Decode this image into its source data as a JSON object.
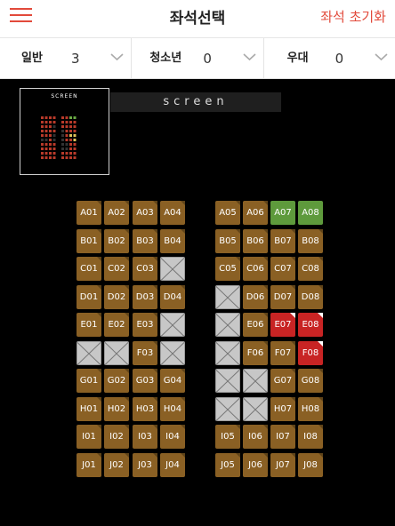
{
  "header": {
    "title": "좌석선택",
    "reset_label": "좌석 초기화"
  },
  "audience": [
    {
      "label": "일반",
      "value": "3"
    },
    {
      "label": "청소년",
      "value": "0"
    },
    {
      "label": "우대",
      "value": "0"
    }
  ],
  "minimap_title": "SCREEN",
  "screen_label": "screen",
  "colors": {
    "available": "#8a6024",
    "selected": "#5e9a3c",
    "reserved": "#c82424",
    "blocked": "#c7c7c7",
    "accent": "#e24a3b"
  },
  "rows": [
    {
      "left": [
        [
          "A01",
          "available"
        ],
        [
          "A02",
          "available"
        ],
        [
          "A03",
          "available"
        ],
        [
          "A04",
          "available"
        ]
      ],
      "right": [
        [
          "A05",
          "available"
        ],
        [
          "A06",
          "available"
        ],
        [
          "A07",
          "selected"
        ],
        [
          "A08",
          "selected"
        ]
      ]
    },
    {
      "left": [
        [
          "B01",
          "available"
        ],
        [
          "B02",
          "available"
        ],
        [
          "B03",
          "available"
        ],
        [
          "B04",
          "available"
        ]
      ],
      "right": [
        [
          "B05",
          "available"
        ],
        [
          "B06",
          "available"
        ],
        [
          "B07",
          "available"
        ],
        [
          "B08",
          "available"
        ]
      ]
    },
    {
      "left": [
        [
          "C01",
          "available"
        ],
        [
          "C02",
          "available"
        ],
        [
          "C03",
          "available"
        ],
        [
          "",
          "blocked"
        ]
      ],
      "right": [
        [
          "C05",
          "available"
        ],
        [
          "C06",
          "available"
        ],
        [
          "C07",
          "available"
        ],
        [
          "C08",
          "available"
        ]
      ]
    },
    {
      "left": [
        [
          "D01",
          "available"
        ],
        [
          "D02",
          "available"
        ],
        [
          "D03",
          "available"
        ],
        [
          "D04",
          "available"
        ]
      ],
      "right": [
        [
          "",
          "blocked"
        ],
        [
          "D06",
          "available"
        ],
        [
          "D07",
          "available"
        ],
        [
          "D08",
          "available"
        ]
      ]
    },
    {
      "left": [
        [
          "E01",
          "available"
        ],
        [
          "E02",
          "available"
        ],
        [
          "E03",
          "available"
        ],
        [
          "",
          "blocked"
        ]
      ],
      "right": [
        [
          "",
          "blocked"
        ],
        [
          "E06",
          "available"
        ],
        [
          "E07",
          "reserved"
        ],
        [
          "E08",
          "reserved"
        ]
      ]
    },
    {
      "left": [
        [
          "",
          "blocked"
        ],
        [
          "",
          "blocked"
        ],
        [
          "F03",
          "available"
        ],
        [
          "",
          "blocked"
        ]
      ],
      "right": [
        [
          "",
          "blocked"
        ],
        [
          "F06",
          "available"
        ],
        [
          "F07",
          "available"
        ],
        [
          "F08",
          "reserved"
        ]
      ]
    },
    {
      "left": [
        [
          "G01",
          "available"
        ],
        [
          "G02",
          "available"
        ],
        [
          "G03",
          "available"
        ],
        [
          "G04",
          "available"
        ]
      ],
      "right": [
        [
          "",
          "blocked"
        ],
        [
          "",
          "blocked"
        ],
        [
          "G07",
          "available"
        ],
        [
          "G08",
          "available"
        ]
      ]
    },
    {
      "left": [
        [
          "H01",
          "available"
        ],
        [
          "H02",
          "available"
        ],
        [
          "H03",
          "available"
        ],
        [
          "H04",
          "available"
        ]
      ],
      "right": [
        [
          "",
          "blocked"
        ],
        [
          "",
          "blocked"
        ],
        [
          "H07",
          "available"
        ],
        [
          "H08",
          "available"
        ]
      ]
    },
    {
      "left": [
        [
          "I01",
          "available"
        ],
        [
          "I02",
          "available"
        ],
        [
          "I03",
          "available"
        ],
        [
          "I04",
          "available"
        ]
      ],
      "right": [
        [
          "I05",
          "available"
        ],
        [
          "I06",
          "available"
        ],
        [
          "I07",
          "available"
        ],
        [
          "I08",
          "available"
        ]
      ]
    },
    {
      "left": [
        [
          "J01",
          "available"
        ],
        [
          "J02",
          "available"
        ],
        [
          "J03",
          "available"
        ],
        [
          "J04",
          "available"
        ]
      ],
      "right": [
        [
          "J05",
          "available"
        ],
        [
          "J06",
          "available"
        ],
        [
          "J07",
          "available"
        ],
        [
          "J08",
          "available"
        ]
      ]
    }
  ]
}
